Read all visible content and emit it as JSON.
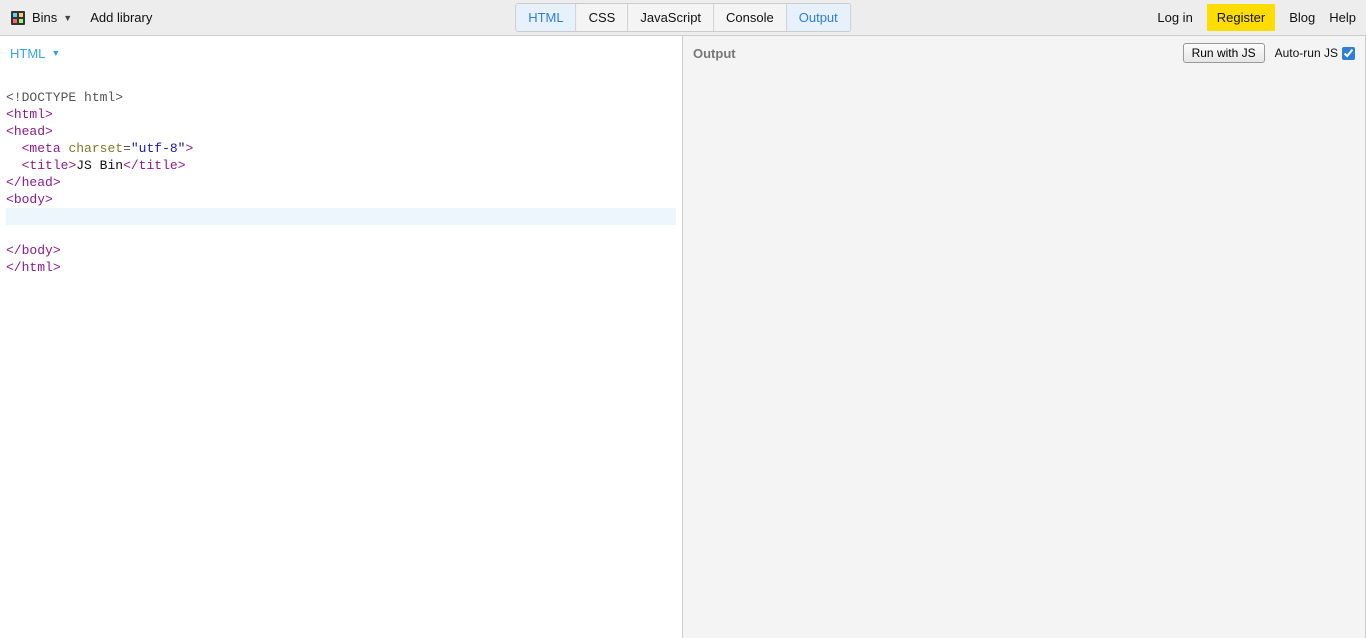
{
  "topbar": {
    "bins_label": "Bins",
    "add_library_label": "Add library",
    "tabs": [
      {
        "label": "HTML",
        "active": true
      },
      {
        "label": "CSS",
        "active": false
      },
      {
        "label": "JavaScript",
        "active": false
      },
      {
        "label": "Console",
        "active": false
      },
      {
        "label": "Output",
        "active": true
      }
    ],
    "login_label": "Log in",
    "register_label": "Register",
    "blog_label": "Blog",
    "help_label": "Help"
  },
  "left_panel": {
    "title": "HTML",
    "code": {
      "doctype": "<!DOCTYPE html>",
      "html_open": "html",
      "head_open": "head",
      "meta_tag": "meta",
      "meta_attr_name": "charset",
      "meta_attr_val": "\"utf-8\"",
      "title_tag": "title",
      "title_text": "JS Bin",
      "head_close": "head",
      "body_open": "body",
      "body_close": "body",
      "html_close": "html"
    }
  },
  "right_panel": {
    "title": "Output",
    "run_label": "Run with JS",
    "autorun_label": "Auto-run JS",
    "autorun_checked": true
  }
}
